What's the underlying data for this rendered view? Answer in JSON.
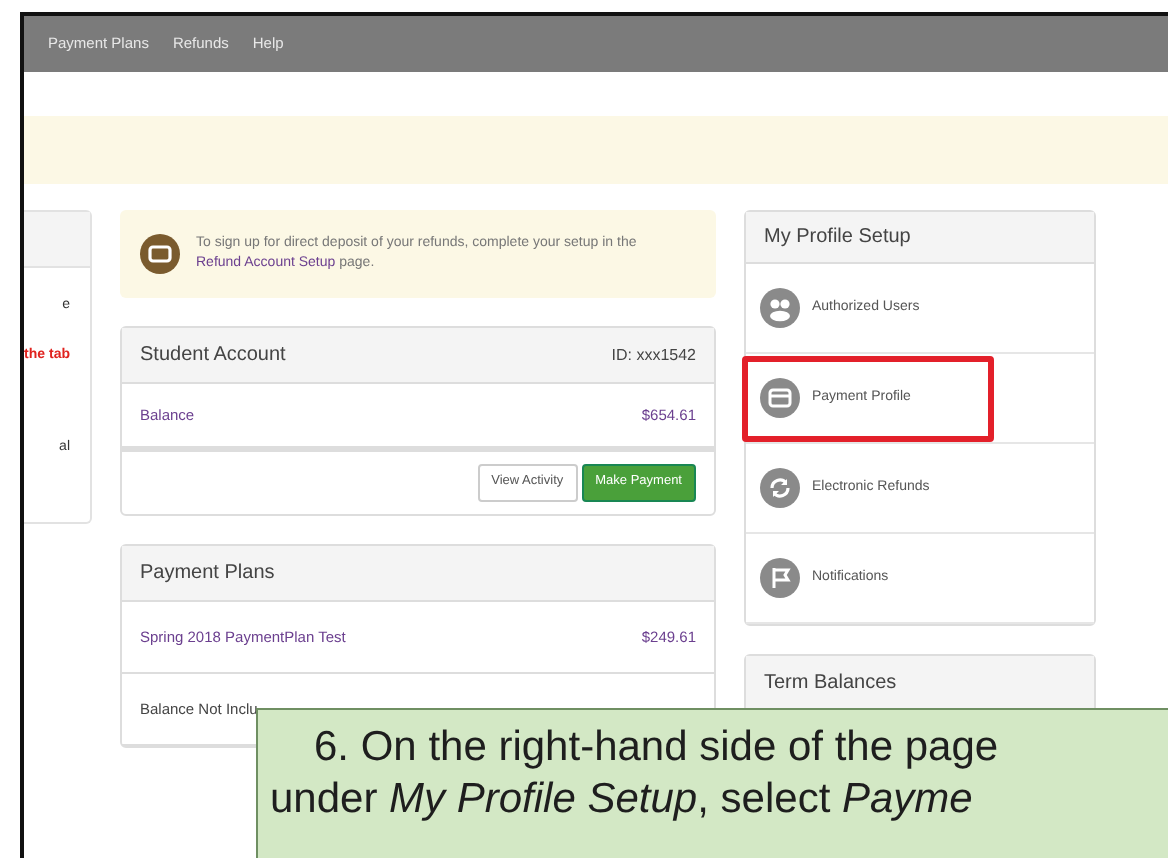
{
  "nav": {
    "items": [
      {
        "label": "Payment Plans"
      },
      {
        "label": "Refunds"
      },
      {
        "label": "Help"
      }
    ]
  },
  "left_panel": {
    "lines": [
      {
        "text": "e",
        "alert": false
      },
      {
        "text": "the tab",
        "alert": true
      },
      {
        "text": "al",
        "alert": false
      }
    ]
  },
  "notice": {
    "text": "To sign up for direct deposit of your refunds, complete your setup in the",
    "link": "Refund Account Setup",
    "after": "page."
  },
  "student_account": {
    "title": "Student Account",
    "id": "ID: xxx1542",
    "rows": [
      {
        "label": "Balance",
        "amount": "$654.61"
      }
    ],
    "buttons": [
      {
        "label": "View Activity",
        "kind": "secondary"
      },
      {
        "label": "Make Payment",
        "kind": "success"
      }
    ]
  },
  "payment_plans": {
    "title": "Payment Plans",
    "rows": [
      {
        "label": "Spring 2018 PaymentPlan Test",
        "amount": "$249.61",
        "link": true
      },
      {
        "label": "Balance Not Inclu",
        "link": false
      }
    ]
  },
  "profile_setup": {
    "title": "My Profile Setup",
    "items": [
      {
        "label": "Authorized Users",
        "kind": "users",
        "highlighted": false
      },
      {
        "label": "Payment Profile",
        "kind": "card",
        "highlighted": true
      },
      {
        "label": "Electronic Refunds",
        "kind": "refresh",
        "highlighted": false
      },
      {
        "label": "Notifications",
        "kind": "flag",
        "highlighted": false
      }
    ]
  },
  "term_balances": {
    "title": "Term Balances"
  },
  "callout": {
    "lines": [
      "6. On the right-hand side of the page",
      "under *My Profile Setup*, select *Payme*"
    ]
  }
}
